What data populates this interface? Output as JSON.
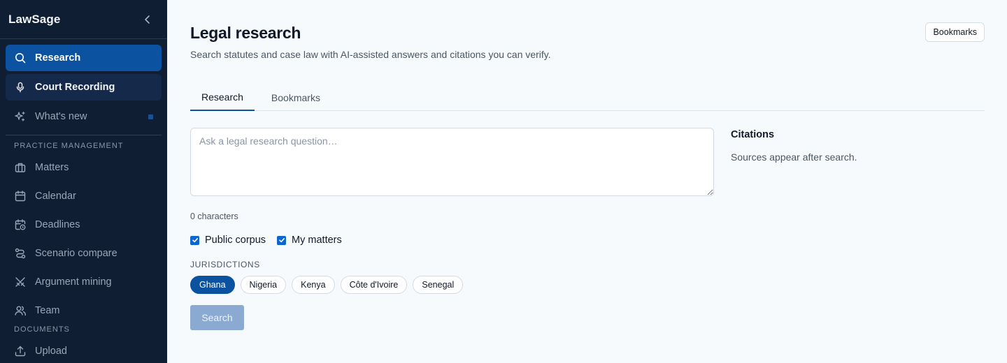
{
  "app": {
    "name": "LawSage"
  },
  "sidebar": {
    "items": [
      {
        "label": "Research",
        "icon": "search-icon",
        "state": "active"
      },
      {
        "label": "Court Recording",
        "icon": "microphone-icon",
        "state": "highlighted"
      },
      {
        "label": "What's new",
        "icon": "sparkles-icon",
        "state": "normal"
      }
    ],
    "sections": [
      {
        "label": "PRACTICE MANAGEMENT",
        "items": [
          {
            "label": "Matters",
            "icon": "briefcase-icon"
          },
          {
            "label": "Calendar",
            "icon": "calendar-icon"
          },
          {
            "label": "Deadlines",
            "icon": "calendar-clock-icon"
          },
          {
            "label": "Scenario compare",
            "icon": "route-icon"
          },
          {
            "label": "Argument mining",
            "icon": "swords-icon"
          },
          {
            "label": "Team",
            "icon": "users-icon"
          }
        ]
      },
      {
        "label": "DOCUMENTS",
        "items": [
          {
            "label": "Upload",
            "icon": "upload-icon"
          }
        ]
      }
    ]
  },
  "header": {
    "title": "Legal research",
    "subtitle": "Search statutes and case law with AI-assisted answers and citations you can verify.",
    "bookmarks_label": "Bookmarks"
  },
  "tabs": [
    {
      "label": "Research",
      "active": true
    },
    {
      "label": "Bookmarks",
      "active": false
    }
  ],
  "search": {
    "placeholder": "Ask a legal research question…",
    "value": "",
    "char_count": "0 characters",
    "sources": [
      {
        "label": "Public corpus",
        "checked": true
      },
      {
        "label": "My matters",
        "checked": true
      }
    ],
    "jurisdictions_label": "JURISDICTIONS",
    "jurisdictions": [
      {
        "label": "Ghana",
        "selected": true
      },
      {
        "label": "Nigeria",
        "selected": false
      },
      {
        "label": "Kenya",
        "selected": false
      },
      {
        "label": "Côte d'Ivoire",
        "selected": false
      },
      {
        "label": "Senegal",
        "selected": false
      }
    ],
    "button_label": "Search"
  },
  "citations": {
    "title": "Citations",
    "empty_text": "Sources appear after search."
  },
  "colors": {
    "sidebar_bg": "#0f1e33",
    "accent": "#0b53a0",
    "page_bg": "#f7fafd",
    "search_button_disabled": "#8aaad2"
  }
}
